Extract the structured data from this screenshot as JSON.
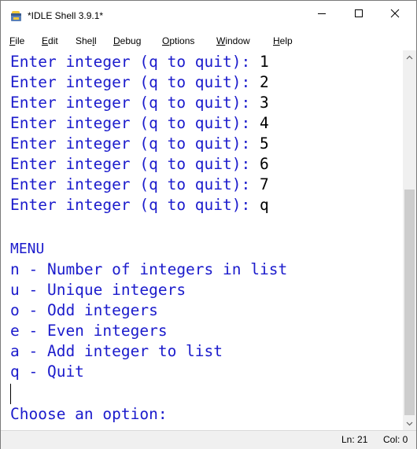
{
  "window": {
    "title": "*IDLE Shell 3.9.1*",
    "controls": {
      "minimize": "—",
      "maximize": "☐",
      "close": "✕"
    }
  },
  "menu": [
    {
      "label": "File",
      "mnemonic": "F",
      "rest": "ile"
    },
    {
      "label": "Edit",
      "mnemonic": "E",
      "rest": "dit"
    },
    {
      "label": "Shell",
      "pre": "She",
      "mnemonic": "l",
      "rest": "l"
    },
    {
      "label": "Debug",
      "mnemonic": "D",
      "rest": "ebug"
    },
    {
      "label": "Options",
      "mnemonic": "O",
      "rest": "ptions"
    },
    {
      "label": "Window",
      "mnemonic": "W",
      "rest": "indow"
    },
    {
      "label": "Help",
      "mnemonic": "H",
      "rest": "elp"
    }
  ],
  "shell": {
    "entries": [
      {
        "prompt": "Enter integer (q to quit): ",
        "value": "1"
      },
      {
        "prompt": "Enter integer (q to quit): ",
        "value": "2"
      },
      {
        "prompt": "Enter integer (q to quit): ",
        "value": "3"
      },
      {
        "prompt": "Enter integer (q to quit): ",
        "value": "4"
      },
      {
        "prompt": "Enter integer (q to quit): ",
        "value": "5"
      },
      {
        "prompt": "Enter integer (q to quit): ",
        "value": "6"
      },
      {
        "prompt": "Enter integer (q to quit): ",
        "value": "7"
      },
      {
        "prompt": "Enter integer (q to quit): ",
        "value": "q"
      }
    ],
    "menu_title": "MENU",
    "menu_options": [
      "n - Number of integers in list",
      "u - Unique integers",
      "o - Odd integers",
      "e - Even integers",
      "a - Add integer to list",
      "q - Quit"
    ],
    "choose_prompt": "Choose an option:"
  },
  "status": {
    "line": "Ln: 21",
    "col": "Col: 0"
  },
  "colors": {
    "output_blue": "#1b1bcc",
    "input_black": "#000000"
  }
}
